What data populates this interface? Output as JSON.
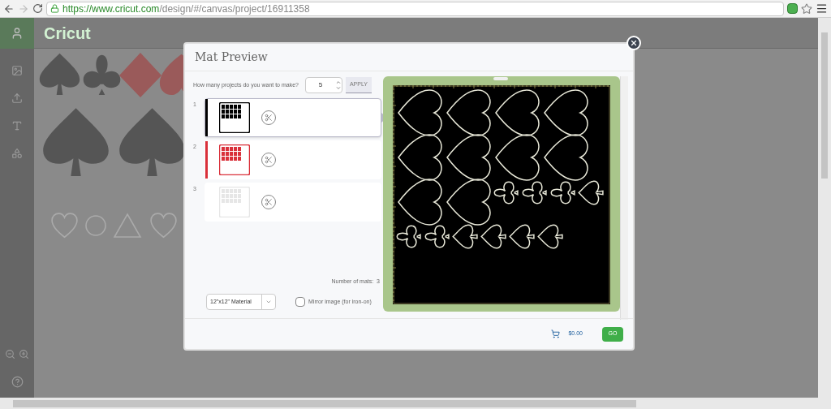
{
  "browser": {
    "url_host": "https://www.cricut.com",
    "url_path": "/design/#/canvas/project/16911358"
  },
  "app": {
    "logo": "Cricut"
  },
  "dialog": {
    "title": "Mat Preview",
    "quantity": {
      "label": "How many projects do you want to make?",
      "value": "5",
      "apply": "APPLY"
    },
    "mats": [
      {
        "number": "1",
        "selected": true,
        "color": "#000000"
      },
      {
        "number": "2",
        "selected": false,
        "color": "#d9303a"
      },
      {
        "number": "3",
        "selected": false,
        "color": "#e6e6e6"
      }
    ],
    "mat_count": "Number of mats:  3",
    "material": "12\"x12\" Material",
    "mirror": {
      "label": "Mirror image (for iron-on)",
      "checked": false
    },
    "price": "$0.00",
    "go": "GO"
  }
}
